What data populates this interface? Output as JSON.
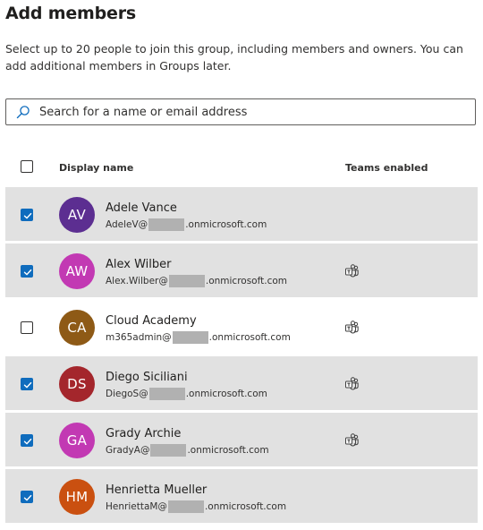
{
  "page": {
    "title": "Add members",
    "description": "Select up to 20 people to join this group, including members and owners. You can add additional members in Groups later."
  },
  "search": {
    "placeholder": "Search for a name or email address",
    "value": ""
  },
  "table": {
    "header": {
      "display_name": "Display name",
      "teams_enabled": "Teams enabled",
      "select_all_checked": false
    },
    "rows": [
      {
        "name": "Adele Vance",
        "initials": "AV",
        "avatar_color": "#5c2e91",
        "email_prefix": "AdeleV@",
        "email_suffix": ".onmicrosoft.com",
        "checked": true,
        "teams": false
      },
      {
        "name": "Alex Wilber",
        "initials": "AW",
        "avatar_color": "#c239b3",
        "email_prefix": "Alex.Wilber@",
        "email_suffix": ".onmicrosoft.com",
        "checked": true,
        "teams": true
      },
      {
        "name": "Cloud Academy",
        "initials": "CA",
        "avatar_color": "#8e5a16",
        "email_prefix": "m365admin@",
        "email_suffix": ".onmicrosoft.com",
        "checked": false,
        "teams": true
      },
      {
        "name": "Diego Siciliani",
        "initials": "DS",
        "avatar_color": "#a4262c",
        "email_prefix": "DiegoS@",
        "email_suffix": ".onmicrosoft.com",
        "checked": true,
        "teams": true
      },
      {
        "name": "Grady Archie",
        "initials": "GA",
        "avatar_color": "#c239b3",
        "email_prefix": "GradyA@",
        "email_suffix": ".onmicrosoft.com",
        "checked": true,
        "teams": true
      },
      {
        "name": "Henrietta Mueller",
        "initials": "HM",
        "avatar_color": "#ca5010",
        "email_prefix": "HenriettaM@",
        "email_suffix": ".onmicrosoft.com",
        "checked": true,
        "teams": false
      }
    ]
  },
  "colors": {
    "accent": "#0f6cbd",
    "selected_row": "#e1e1e1"
  }
}
